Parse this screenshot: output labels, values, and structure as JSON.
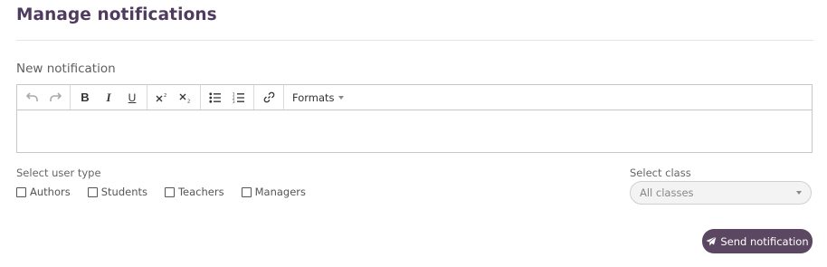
{
  "page": {
    "title": "Manage notifications"
  },
  "editor": {
    "label": "New notification",
    "content": "",
    "toolbar": {
      "undo_icon": "undo-icon",
      "redo_icon": "redo-icon",
      "bold_label": "B",
      "italic_label": "I",
      "underline_label": "U",
      "superscript_icon": "superscript-icon",
      "subscript_icon": "subscript-icon",
      "bullet_list_icon": "bullet-list-icon",
      "numbered_list_icon": "numbered-list-icon",
      "link_icon": "link-icon",
      "formats_label": "Formats"
    }
  },
  "user_type": {
    "label": "Select user type",
    "options": [
      {
        "label": "Authors",
        "checked": false
      },
      {
        "label": "Students",
        "checked": false
      },
      {
        "label": "Teachers",
        "checked": false
      },
      {
        "label": "Managers",
        "checked": false
      }
    ]
  },
  "class_select": {
    "label": "Select class",
    "value": "All classes"
  },
  "send_button": {
    "label": "Send notification",
    "icon": "paper-plane-icon"
  },
  "colors": {
    "brand": "#4e3b5e",
    "button": "#5b4761"
  }
}
